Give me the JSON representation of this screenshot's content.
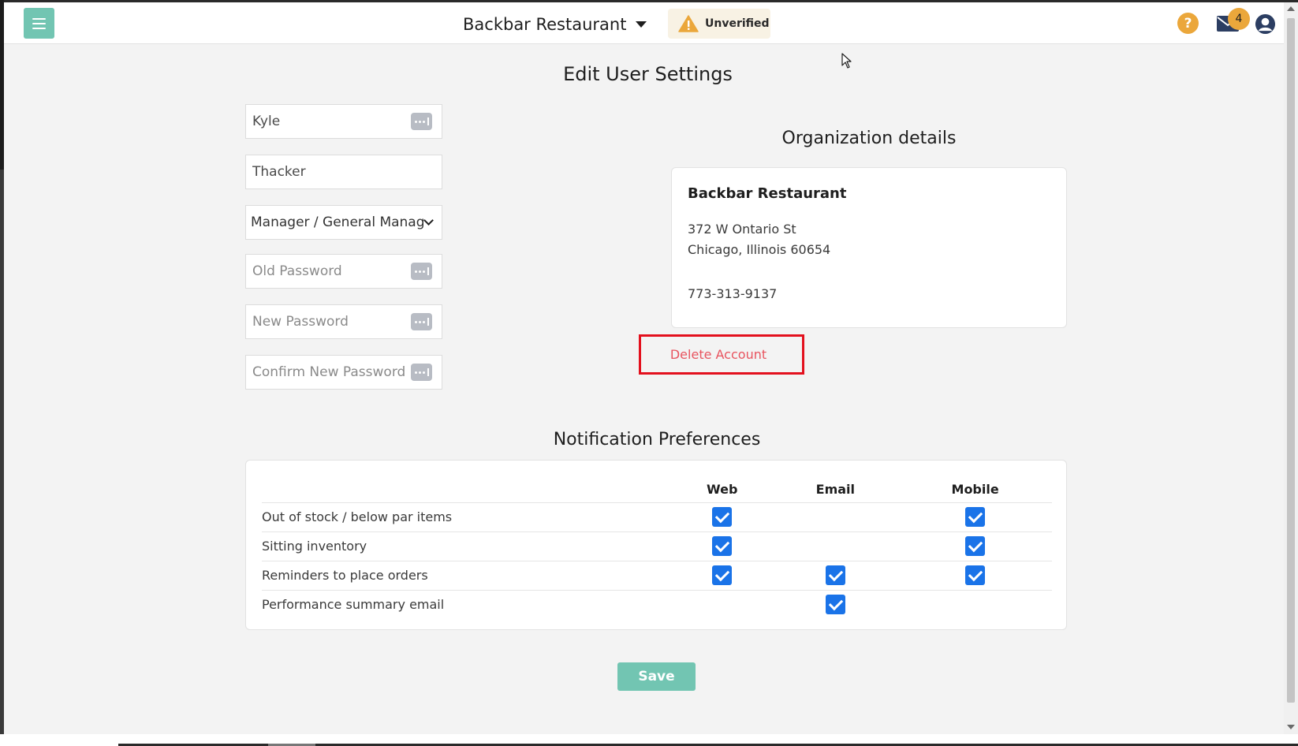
{
  "header": {
    "org_name": "Backbar Restaurant",
    "status_badge": "Unverified",
    "help_symbol": "?",
    "mail_count": "4",
    "menu_icon": "hamburger-icon",
    "warning_icon": "warning-triangle-icon",
    "user_icon": "user-circle-icon",
    "accent_color": "#72c5b2",
    "badge_color": "#eba73b"
  },
  "page": {
    "title": "Edit User Settings"
  },
  "user_form": {
    "first_name": "Kyle",
    "last_name": "Thacker",
    "role_selected": "Manager / General Manag",
    "old_password_placeholder": "Old Password",
    "new_password_placeholder": "New Password",
    "confirm_password_placeholder": "Confirm New Password"
  },
  "organization": {
    "heading": "Organization details",
    "name": "Backbar Restaurant",
    "address_line1": "372 W Ontario St",
    "address_line2": "Chicago, Illinois 60654",
    "phone": "773-313-9137"
  },
  "delete_account": {
    "label": "Delete Account",
    "highlight_color": "#e3101d"
  },
  "notifications": {
    "heading": "Notification Preferences",
    "columns": [
      "Web",
      "Email",
      "Mobile"
    ],
    "rows": [
      {
        "label": "Out of stock / below par items",
        "web": true,
        "email": false,
        "mobile": true
      },
      {
        "label": "Sitting inventory",
        "web": true,
        "email": false,
        "mobile": true
      },
      {
        "label": "Reminders to place orders",
        "web": true,
        "email": true,
        "mobile": true
      },
      {
        "label": "Performance summary email",
        "web": false,
        "email": true,
        "mobile": false
      }
    ],
    "checkbox_color": "#1a73e8"
  },
  "actions": {
    "save_label": "Save"
  }
}
